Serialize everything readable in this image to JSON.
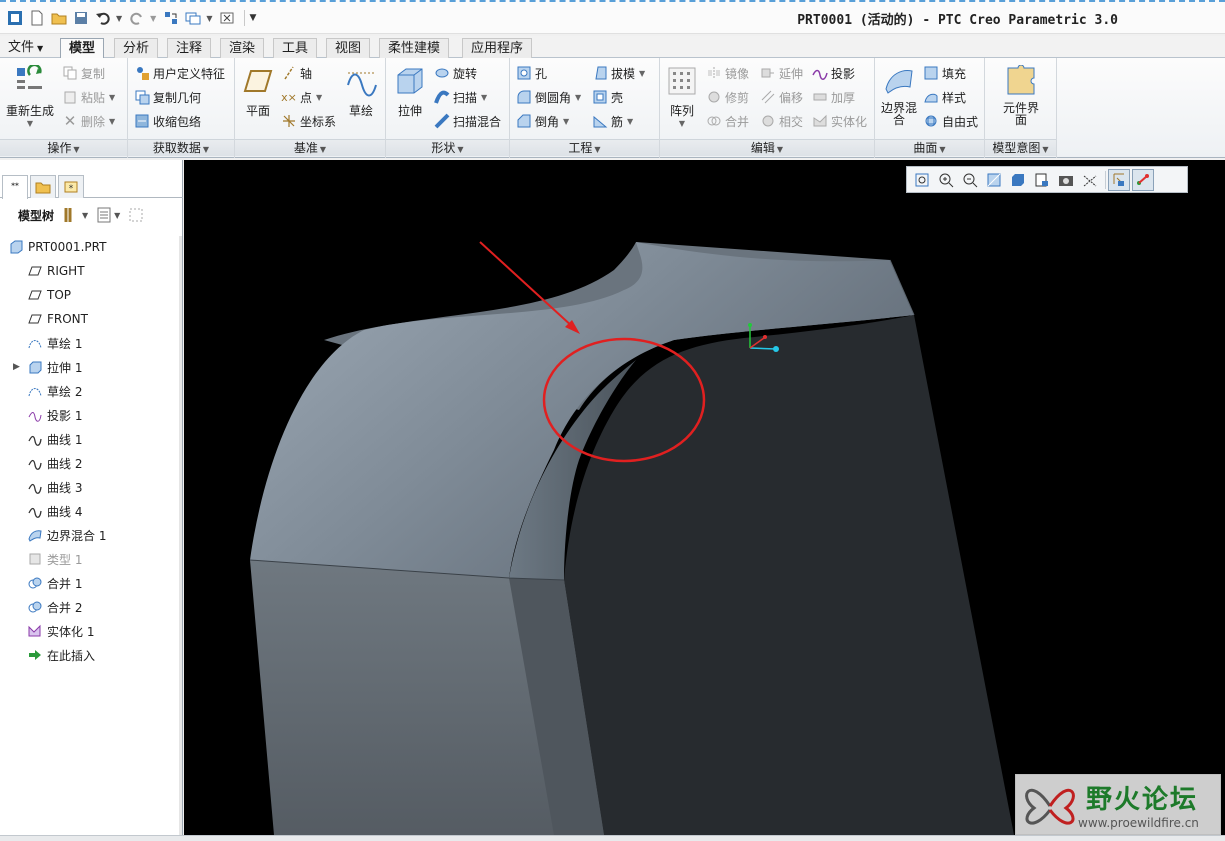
{
  "window": {
    "title": "PRT0001 (活动的) - PTC Creo Parametric 3.0"
  },
  "tabs": [
    {
      "label": "文件"
    },
    {
      "label": "模型"
    },
    {
      "label": "分析"
    },
    {
      "label": "注释"
    },
    {
      "label": "渲染"
    },
    {
      "label": "工具"
    },
    {
      "label": "视图"
    },
    {
      "label": "柔性建模"
    },
    {
      "label": "应用程序"
    }
  ],
  "ribbon": {
    "groups": {
      "operations": {
        "label": "操作",
        "regen": "重新生成",
        "copy": "复制",
        "paste": "粘贴",
        "delete": "删除"
      },
      "getdata": {
        "label": "获取数据",
        "udf": "用户定义特征",
        "copygeom": "复制几何",
        "shrinkwrap": "收缩包络"
      },
      "datum": {
        "label": "基准",
        "plane": "平面",
        "axis": "轴",
        "point": "点",
        "csys": "坐标系",
        "sketch": "草绘"
      },
      "shapes": {
        "label": "形状",
        "extrude": "拉伸",
        "revolve": "旋转",
        "sweep": "扫描",
        "sweptblend": "扫描混合"
      },
      "engineering": {
        "label": "工程",
        "hole": "孔",
        "round": "倒圆角",
        "chamfer": "倒角",
        "draft": "拔模",
        "shell": "壳",
        "rib": "筋"
      },
      "editing": {
        "label": "编辑",
        "pattern": "阵列",
        "mirror": "镜像",
        "trim": "修剪",
        "merge": "合并",
        "extend": "延伸",
        "offset": "偏移",
        "intersect": "相交",
        "project": "投影",
        "thicken": "加厚",
        "solidify": "实体化"
      },
      "surfaces": {
        "label": "曲面",
        "boundary": "边界混合",
        "fill": "填充",
        "style": "样式",
        "freestyle": "自由式"
      },
      "modelintent": {
        "label": "模型意图",
        "component": "元件界面"
      }
    }
  },
  "modeltree": {
    "header": "模型树",
    "nodes": [
      {
        "label": "PRT0001.PRT",
        "icon": "part-icon"
      },
      {
        "label": "RIGHT",
        "icon": "datum-plane-icon"
      },
      {
        "label": "TOP",
        "icon": "datum-plane-icon"
      },
      {
        "label": "FRONT",
        "icon": "datum-plane-icon"
      },
      {
        "label": "草绘 1",
        "icon": "sketch-icon"
      },
      {
        "label": "拉伸 1",
        "icon": "extrude-icon"
      },
      {
        "label": "草绘 2",
        "icon": "sketch-icon"
      },
      {
        "label": "投影 1",
        "icon": "projection-icon"
      },
      {
        "label": "曲线 1",
        "icon": "curve-icon"
      },
      {
        "label": "曲线 2",
        "icon": "curve-icon"
      },
      {
        "label": "曲线 3",
        "icon": "curve-icon"
      },
      {
        "label": "曲线 4",
        "icon": "curve-icon"
      },
      {
        "label": "边界混合 1",
        "icon": "boundary-blend-icon"
      },
      {
        "label": "类型 1",
        "icon": "type-icon"
      },
      {
        "label": "合并 1",
        "icon": "merge-icon"
      },
      {
        "label": "合并 2",
        "icon": "merge-icon"
      },
      {
        "label": "实体化 1",
        "icon": "solidify-icon"
      },
      {
        "label": "在此插入",
        "icon": "insert-here-icon"
      }
    ]
  },
  "watermark": {
    "title": "野火论坛",
    "url": "www.proewildfire.cn"
  },
  "colors": {
    "accent": "#1d7a2a",
    "annotation": "#e02020",
    "viewport_bg": "#000000"
  }
}
